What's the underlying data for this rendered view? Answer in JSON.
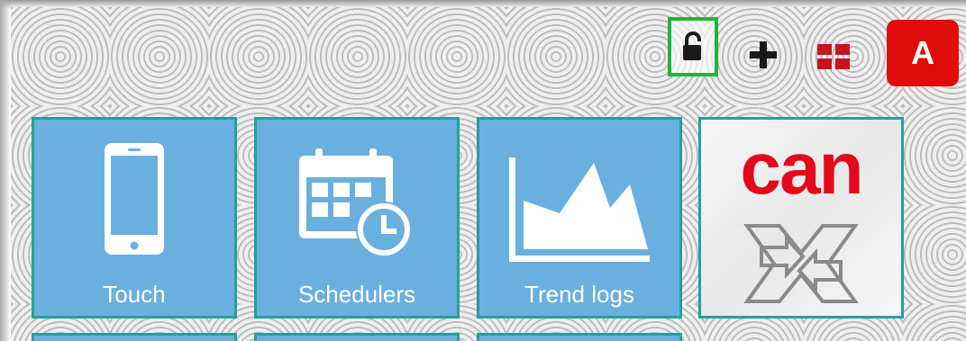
{
  "toolbar": {
    "lock_icon": "unlocked-padlock-icon",
    "add_icon": "plus-icon",
    "dashboard_icon": "grid-icon",
    "user_initial": "A",
    "accent_color": "#e00b0b",
    "highlight_color": "#23b33a"
  },
  "tiles": [
    {
      "label": "Touch",
      "icon": "smartphone-icon"
    },
    {
      "label": "Schedulers",
      "icon": "calendar-clock-icon"
    },
    {
      "label": "Trend logs",
      "icon": "area-chart-icon"
    },
    {
      "label": "",
      "logo_text": "can",
      "icon": "can-gateway-icon"
    }
  ],
  "colors": {
    "tile_bg": "#6ab0de",
    "tile_border": "#24a19c",
    "logo_red": "#e3081b"
  }
}
